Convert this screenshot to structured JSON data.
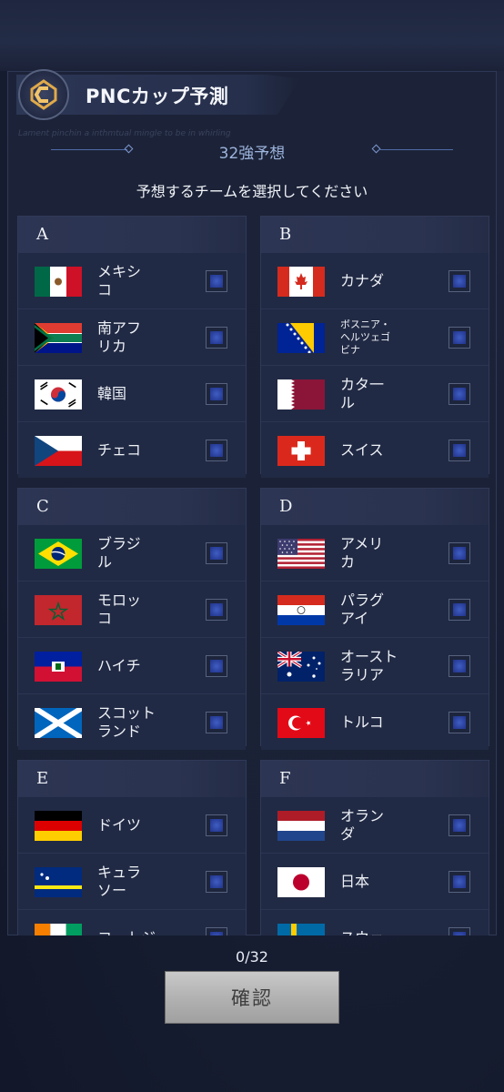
{
  "header": {
    "title": "PNCカップ予測",
    "faint_text": "Lament  pinchin a  inthmtual  mingle  to be in whirling"
  },
  "subtitle": "32強予想",
  "instruction": "予想するチームを選択してください",
  "groups": [
    {
      "label": "A",
      "teams": [
        {
          "name_lines": [
            "メキシ",
            "コ"
          ],
          "flag": "mexico"
        },
        {
          "name_lines": [
            "南アフ",
            "リカ"
          ],
          "flag": "south-africa"
        },
        {
          "name_lines": [
            "韓国"
          ],
          "flag": "korea"
        },
        {
          "name_lines": [
            "チェコ"
          ],
          "flag": "czech"
        }
      ]
    },
    {
      "label": "B",
      "teams": [
        {
          "name_lines": [
            "カナダ"
          ],
          "flag": "canada"
        },
        {
          "name_lines": [
            "ボスニア・",
            "ヘルツェゴ",
            "ビナ"
          ],
          "flag": "bosnia"
        },
        {
          "name_lines": [
            "カタ一",
            "ル"
          ],
          "flag": "qatar"
        },
        {
          "name_lines": [
            "スイス"
          ],
          "flag": "switzerland"
        }
      ]
    },
    {
      "label": "C",
      "teams": [
        {
          "name_lines": [
            "ブラジ",
            "ル"
          ],
          "flag": "brazil"
        },
        {
          "name_lines": [
            "モロッ",
            "コ"
          ],
          "flag": "morocco"
        },
        {
          "name_lines": [
            "ハイチ"
          ],
          "flag": "haiti"
        },
        {
          "name_lines": [
            "スコット",
            "ランド"
          ],
          "flag": "scotland"
        }
      ]
    },
    {
      "label": "D",
      "teams": [
        {
          "name_lines": [
            "アメリ",
            "カ"
          ],
          "flag": "usa"
        },
        {
          "name_lines": [
            "パラグ",
            "アイ"
          ],
          "flag": "paraguay"
        },
        {
          "name_lines": [
            "オースト",
            "ラリア"
          ],
          "flag": "australia"
        },
        {
          "name_lines": [
            "トルコ"
          ],
          "flag": "turkey"
        }
      ]
    },
    {
      "label": "E",
      "teams": [
        {
          "name_lines": [
            "ドイツ"
          ],
          "flag": "germany"
        },
        {
          "name_lines": [
            "キュラ",
            "ソー"
          ],
          "flag": "curacao"
        },
        {
          "name_lines": [
            "コートジ"
          ],
          "flag": "ivory-coast"
        }
      ]
    },
    {
      "label": "F",
      "teams": [
        {
          "name_lines": [
            "オラン",
            "ダ"
          ],
          "flag": "netherlands"
        },
        {
          "name_lines": [
            "日本"
          ],
          "flag": "japan"
        },
        {
          "name_lines": [
            "スウェー"
          ],
          "flag": "sweden"
        }
      ]
    }
  ],
  "counter": "0/32",
  "confirm_label": "確認",
  "colors": {
    "accent": "#3f5ec2",
    "subtitle": "#9db4dc",
    "button": "#b2b2b2"
  }
}
